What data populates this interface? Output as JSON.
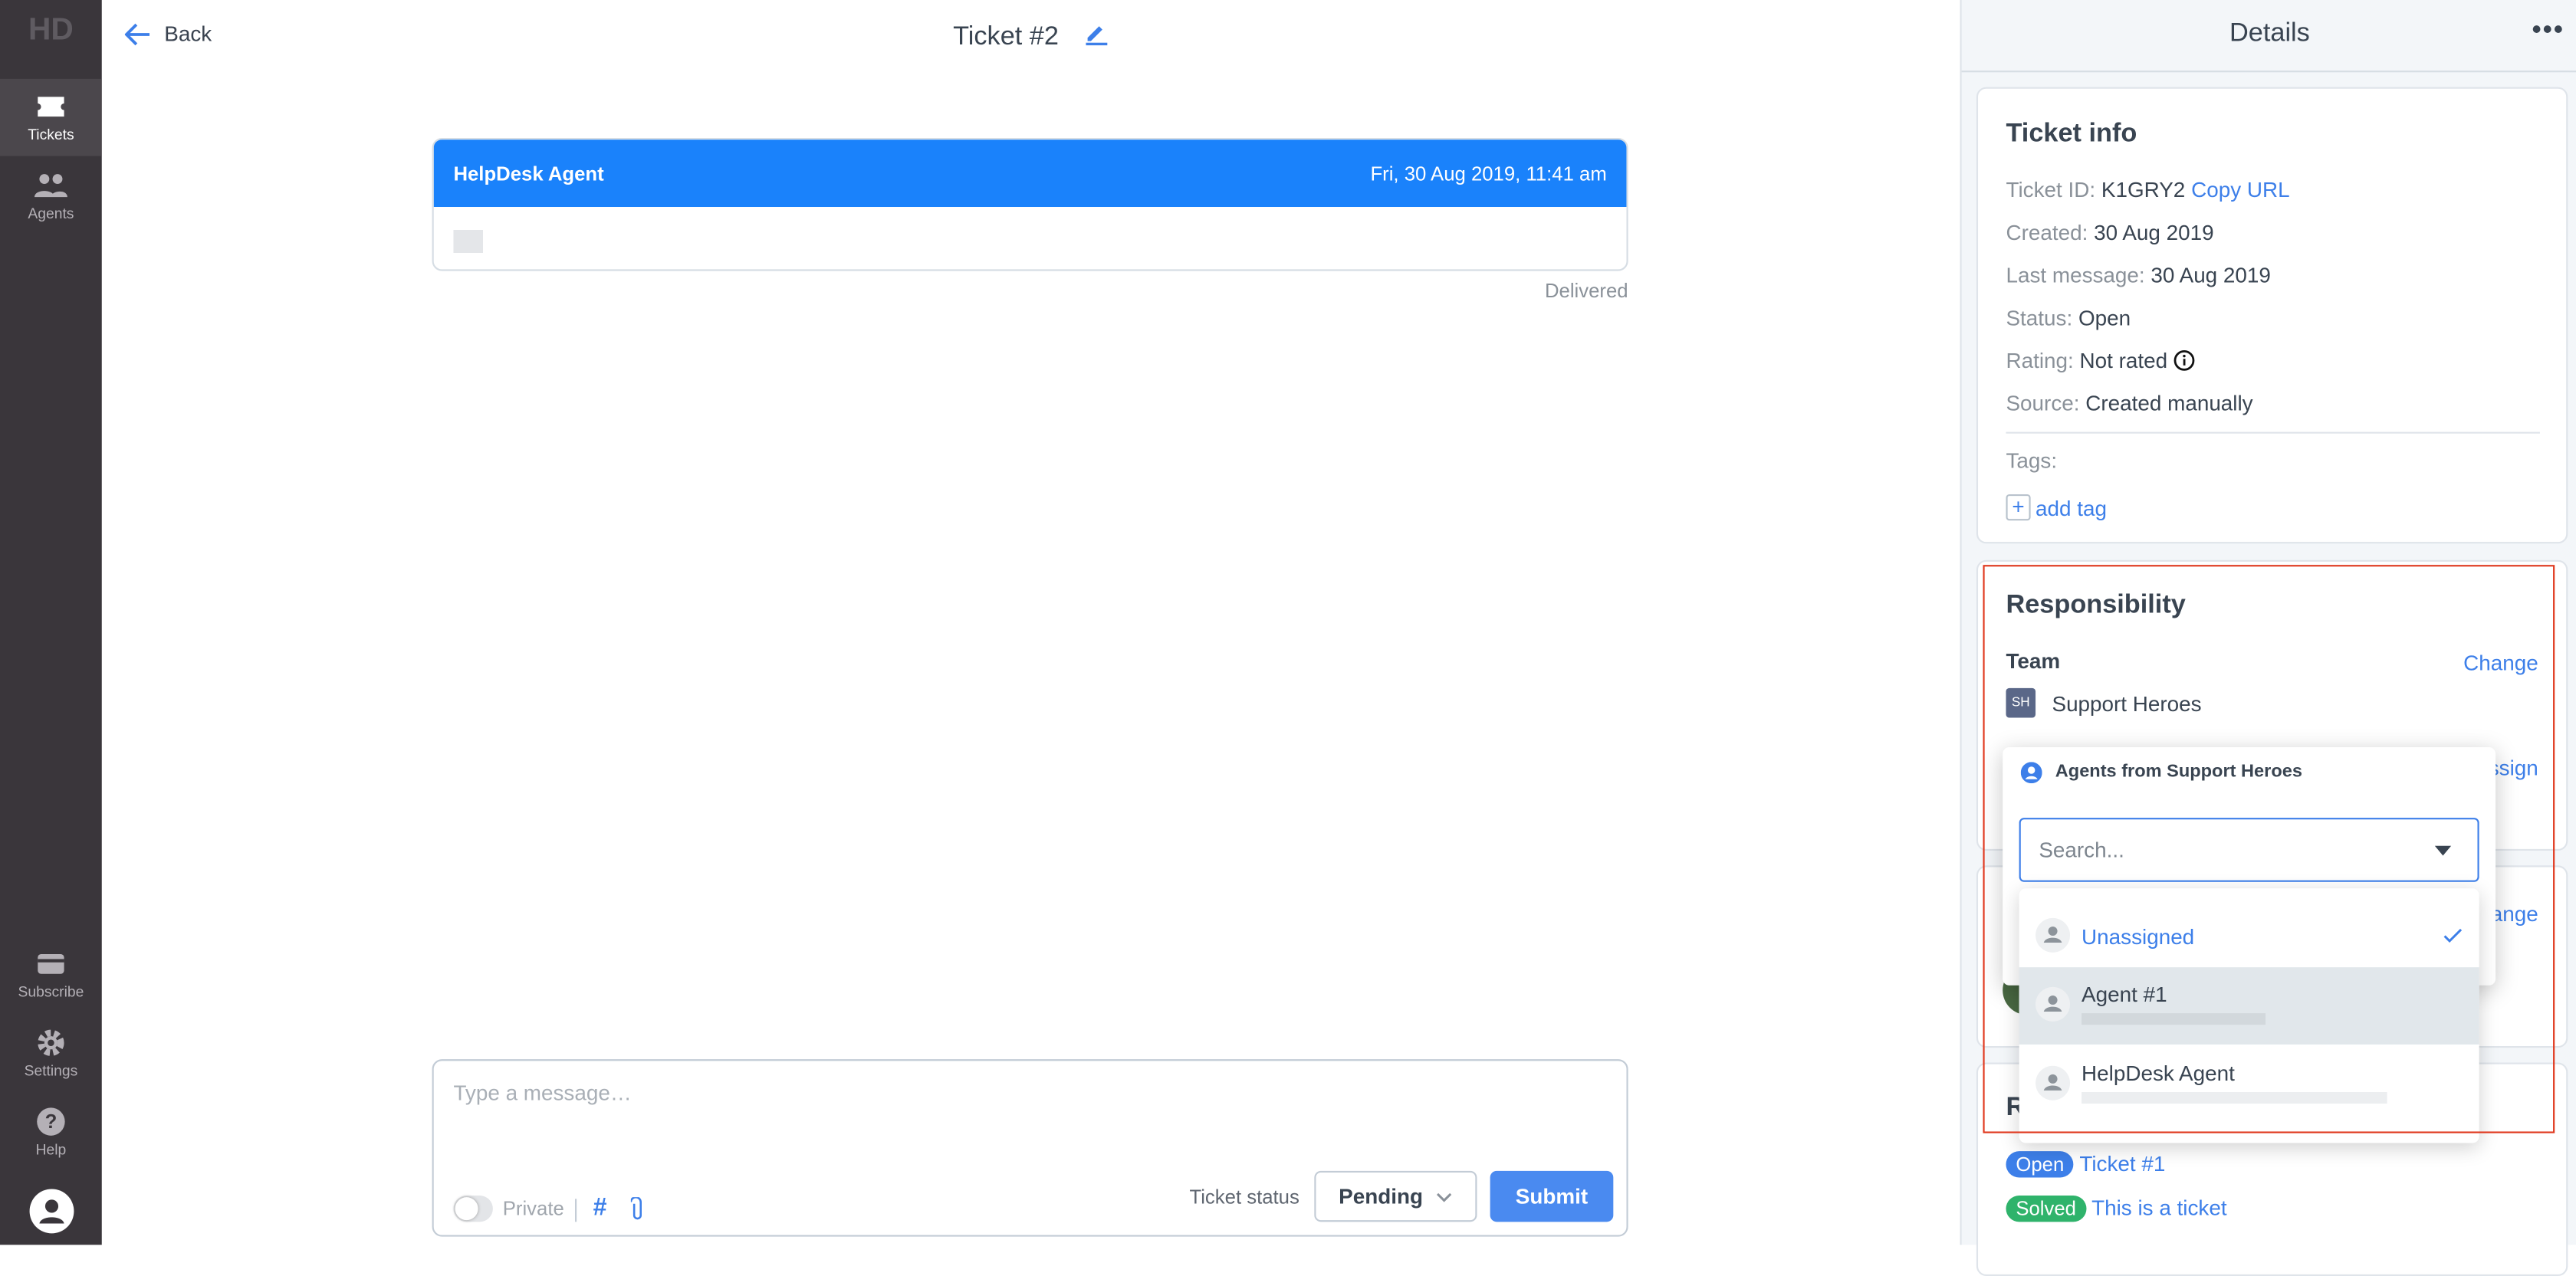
{
  "sidebar": {
    "logo": "HD",
    "items": [
      {
        "label": "Tickets",
        "icon": "ticket-icon",
        "active": true
      },
      {
        "label": "Agents",
        "icon": "agents-icon"
      }
    ],
    "bottom": [
      {
        "label": "Subscribe",
        "icon": "credit-card-icon"
      },
      {
        "label": "Settings",
        "icon": "gear-icon"
      },
      {
        "label": "Help",
        "icon": "help-icon"
      }
    ]
  },
  "header": {
    "back_label": "Back",
    "title": "Ticket #2"
  },
  "message": {
    "author": "HelpDesk Agent",
    "timestamp": "Fri, 30 Aug 2019, 11:41 am",
    "status": "Delivered"
  },
  "composer": {
    "placeholder": "Type a message…",
    "private_label": "Private",
    "hash": "#",
    "ticket_status_label": "Ticket status",
    "ticket_status_value": "Pending",
    "submit_label": "Submit"
  },
  "details": {
    "title": "Details",
    "ticket_info": {
      "title": "Ticket info",
      "id_label": "Ticket ID:",
      "id_value": "K1GRY2",
      "copy_url": "Copy URL",
      "created_label": "Created:",
      "created_value": "30 Aug 2019",
      "last_label": "Last message:",
      "last_value": "30 Aug 2019",
      "status_label": "Status:",
      "status_value": "Open",
      "rating_label": "Rating:",
      "rating_value": "Not rated",
      "source_label": "Source:",
      "source_value": "Created manually",
      "tags_label": "Tags:",
      "add_tag": "add tag"
    },
    "responsibility": {
      "title": "Responsibility",
      "team_label": "Team",
      "change": "Change",
      "team_initials": "SH",
      "team_name": "Support Heroes",
      "assign_partial": "ssign",
      "change_partial": "ange"
    },
    "related": {
      "title_partial": "R",
      "items": [
        {
          "status": "Open",
          "color": "#3d7fe9",
          "title": "Ticket #1"
        },
        {
          "status": "Solved",
          "color": "#2fb36b",
          "title": "This is a ticket"
        }
      ]
    }
  },
  "agent_dropdown": {
    "title": "Agents from Support Heroes",
    "search_placeholder": "Search...",
    "options": [
      {
        "name": "Unassigned",
        "selected": true
      },
      {
        "name": "Agent #1",
        "highlighted": true
      },
      {
        "name": "HelpDesk Agent"
      }
    ]
  },
  "colors": {
    "accent": "#1a82fb",
    "link": "#3d7fe9",
    "sidebar": "#3a363b",
    "highlight_outline": "#e0391f"
  }
}
